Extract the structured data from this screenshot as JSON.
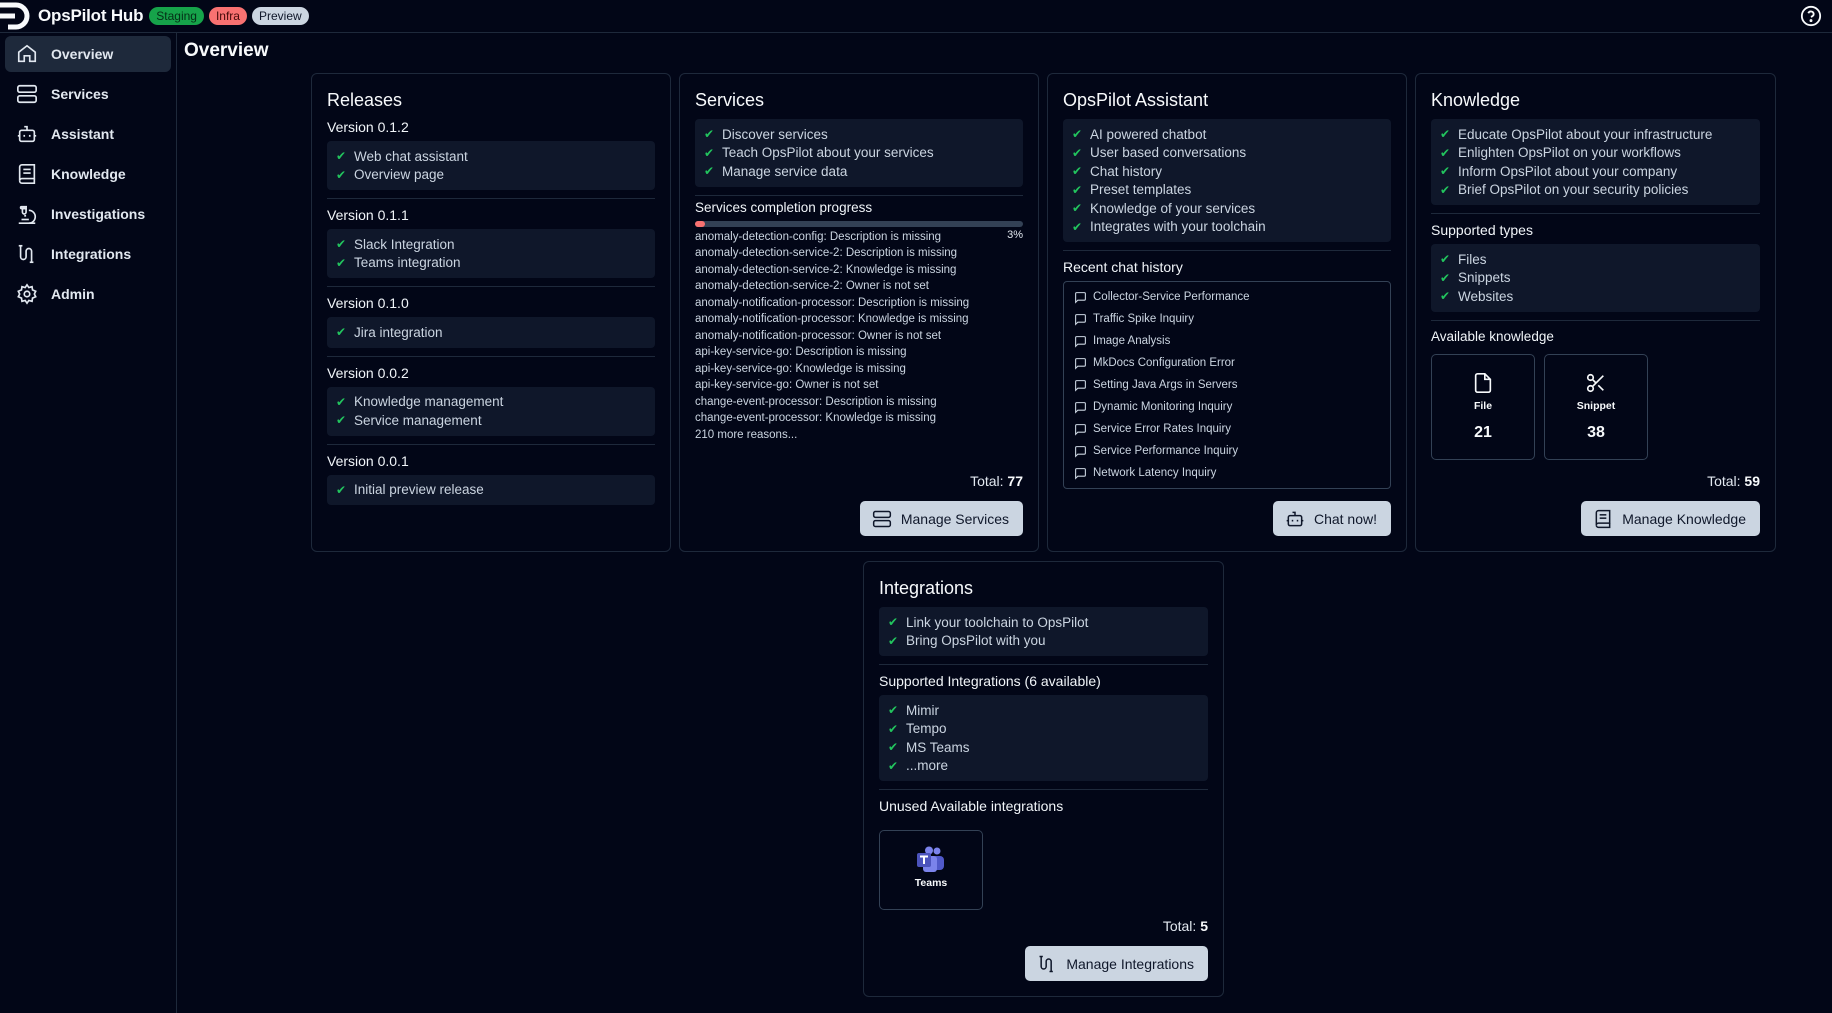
{
  "header": {
    "brand": "OpsPilot Hub",
    "badges": [
      "Staging",
      "Infra",
      "Preview"
    ]
  },
  "sidebar": {
    "items": [
      {
        "label": "Overview",
        "icon": "home-icon"
      },
      {
        "label": "Services",
        "icon": "server-icon"
      },
      {
        "label": "Assistant",
        "icon": "bot-icon"
      },
      {
        "label": "Knowledge",
        "icon": "book-icon"
      },
      {
        "label": "Investigations",
        "icon": "microscope-icon"
      },
      {
        "label": "Integrations",
        "icon": "route-icon"
      },
      {
        "label": "Admin",
        "icon": "gear-icon"
      }
    ]
  },
  "page": {
    "title": "Overview"
  },
  "releases": {
    "title": "Releases",
    "versions": [
      {
        "version": "Version 0.1.2",
        "items": [
          "Web chat assistant",
          "Overview page"
        ]
      },
      {
        "version": "Version 0.1.1",
        "items": [
          "Slack Integration",
          "Teams integration"
        ]
      },
      {
        "version": "Version 0.1.0",
        "items": [
          "Jira integration"
        ]
      },
      {
        "version": "Version 0.0.2",
        "items": [
          "Knowledge management",
          "Service management"
        ]
      },
      {
        "version": "Version 0.0.1",
        "items": [
          "Initial preview release"
        ]
      }
    ]
  },
  "services": {
    "title": "Services",
    "features": [
      "Discover services",
      "Teach OpsPilot about your services",
      "Manage service data"
    ],
    "progress_label": "Services completion progress",
    "progress_value": 3,
    "progress_text": "3%",
    "reasons": [
      "anomaly-detection-config: Description is missing",
      "anomaly-detection-service-2: Description is missing",
      "anomaly-detection-service-2: Knowledge is missing",
      "anomaly-detection-service-2: Owner is not set",
      "anomaly-notification-processor: Description is missing",
      "anomaly-notification-processor: Knowledge is missing",
      "anomaly-notification-processor: Owner is not set",
      "api-key-service-go: Description is missing",
      "api-key-service-go: Knowledge is missing",
      "api-key-service-go: Owner is not set",
      "change-event-processor: Description is missing",
      "change-event-processor: Knowledge is missing",
      "210 more reasons..."
    ],
    "total_label": "Total:",
    "total_value": "77",
    "button": "Manage Services"
  },
  "assistant": {
    "title": "OpsPilot Assistant",
    "features": [
      "AI powered chatbot",
      "User based conversations",
      "Chat history",
      "Preset templates",
      "Knowledge of your services",
      "Integrates with your toolchain"
    ],
    "history_label": "Recent chat history",
    "history": [
      "Collector-Service Performance",
      "Traffic Spike Inquiry",
      "Image Analysis",
      "MkDocs Configuration Error",
      "Setting Java Args in Servers",
      "Dynamic Monitoring Inquiry",
      "Service Error Rates Inquiry",
      "Service Performance Inquiry",
      "Network Latency Inquiry"
    ],
    "button": "Chat now!"
  },
  "knowledge": {
    "title": "Knowledge",
    "features": [
      "Educate OpsPilot about your infrastructure",
      "Enlighten OpsPilot on your workflows",
      "Inform OpsPilot about your company",
      "Brief OpsPilot on your security policies"
    ],
    "types_label": "Supported types",
    "types": [
      "Files",
      "Snippets",
      "Websites"
    ],
    "available_label": "Available knowledge",
    "tiles": [
      {
        "label": "File",
        "count": "21"
      },
      {
        "label": "Snippet",
        "count": "38"
      }
    ],
    "total_label": "Total:",
    "total_value": "59",
    "button": "Manage Knowledge"
  },
  "integrations": {
    "title": "Integrations",
    "features": [
      "Link your toolchain to OpsPilot",
      "Bring OpsPilot with you"
    ],
    "supported_label": "Supported Integrations (6 available)",
    "supported": [
      "Mimir",
      "Tempo",
      "MS Teams",
      "...more"
    ],
    "unused_label": "Unused Available integrations",
    "unused_tile": "Teams",
    "total_label": "Total:",
    "total_value": "5",
    "button": "Manage Integrations"
  },
  "colors": {
    "background": "#020617",
    "accent_green": "#22c55e",
    "progress_red": "#f87171",
    "button_bg": "#cbd5e1"
  }
}
